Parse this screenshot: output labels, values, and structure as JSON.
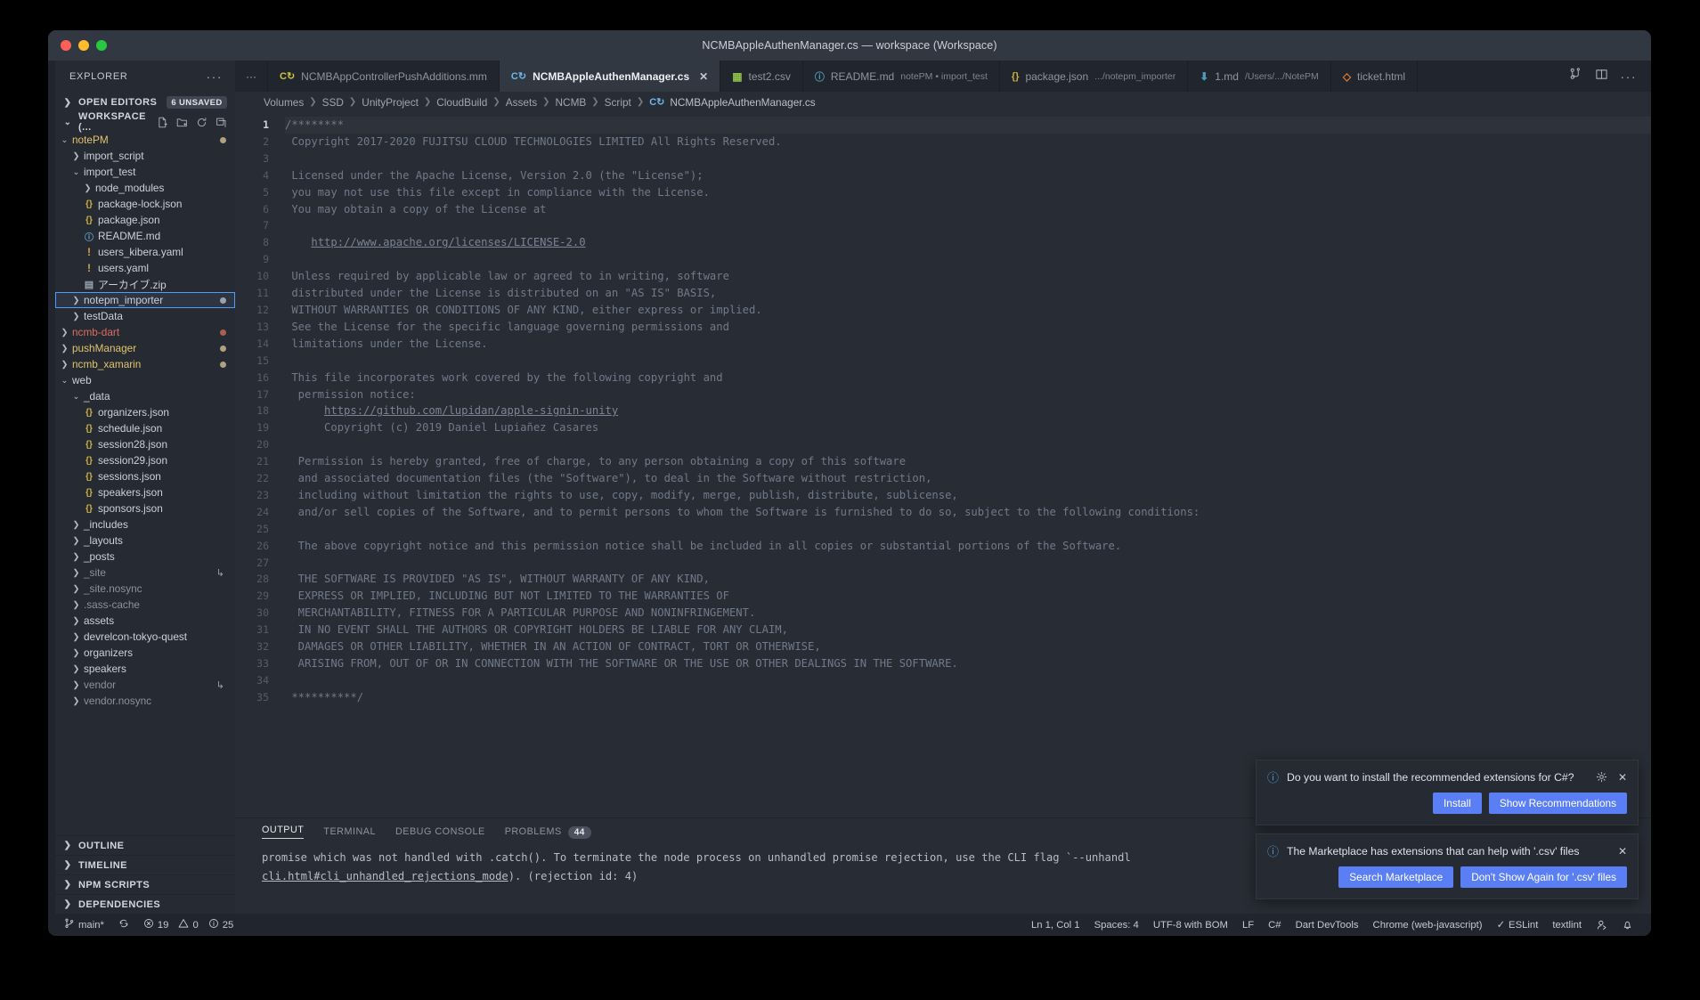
{
  "window": {
    "title": "NCMBAppleAuthenManager.cs — workspace (Workspace)"
  },
  "sidebar": {
    "header": "EXPLORER",
    "sections": {
      "open_editors": "OPEN EDITORS",
      "open_editors_badge": "6 UNSAVED",
      "workspace": "WORKSPACE (..."
    },
    "tree": [
      {
        "label": "notePM",
        "depth": 1,
        "type": "folder",
        "state": "open",
        "color": "folder-y",
        "dot": "tan"
      },
      {
        "label": "import_script",
        "depth": 2,
        "type": "folder",
        "state": "closed",
        "color": ""
      },
      {
        "label": "import_test",
        "depth": 2,
        "type": "folder",
        "state": "open",
        "color": ""
      },
      {
        "label": "node_modules",
        "depth": 3,
        "type": "folder",
        "state": "closed",
        "color": ""
      },
      {
        "label": "package-lock.json",
        "depth": 3,
        "type": "json"
      },
      {
        "label": "package.json",
        "depth": 3,
        "type": "json"
      },
      {
        "label": "README.md",
        "depth": 3,
        "type": "md"
      },
      {
        "label": "users_kibera.yaml",
        "depth": 3,
        "type": "yaml"
      },
      {
        "label": "users.yaml",
        "depth": 3,
        "type": "yaml"
      },
      {
        "label": "アーカイブ.zip",
        "depth": 3,
        "type": "zip"
      },
      {
        "label": "notepm_importer",
        "depth": 2,
        "type": "folder",
        "state": "closed",
        "color": "",
        "selected": true,
        "dot": "gray"
      },
      {
        "label": "testData",
        "depth": 2,
        "type": "folder",
        "state": "closed",
        "color": ""
      },
      {
        "label": "ncmb-dart",
        "depth": 1,
        "type": "folder",
        "state": "closed",
        "color": "folder-r",
        "dot": "red"
      },
      {
        "label": "pushManager",
        "depth": 1,
        "type": "folder",
        "state": "closed",
        "color": "folder-y",
        "dot": "tan"
      },
      {
        "label": "ncmb_xamarin",
        "depth": 1,
        "type": "folder",
        "state": "closed",
        "color": "folder-y",
        "dot": "tan"
      },
      {
        "label": "web",
        "depth": 1,
        "type": "folder",
        "state": "open",
        "color": ""
      },
      {
        "label": "_data",
        "depth": 2,
        "type": "folder",
        "state": "open",
        "color": ""
      },
      {
        "label": "organizers.json",
        "depth": 3,
        "type": "json"
      },
      {
        "label": "schedule.json",
        "depth": 3,
        "type": "json"
      },
      {
        "label": "session28.json",
        "depth": 3,
        "type": "json"
      },
      {
        "label": "session29.json",
        "depth": 3,
        "type": "json"
      },
      {
        "label": "sessions.json",
        "depth": 3,
        "type": "json"
      },
      {
        "label": "speakers.json",
        "depth": 3,
        "type": "json"
      },
      {
        "label": "sponsors.json",
        "depth": 3,
        "type": "json"
      },
      {
        "label": "_includes",
        "depth": 2,
        "type": "folder",
        "state": "closed",
        "color": ""
      },
      {
        "label": "_layouts",
        "depth": 2,
        "type": "folder",
        "state": "closed",
        "color": ""
      },
      {
        "label": "_posts",
        "depth": 2,
        "type": "folder",
        "state": "closed",
        "color": ""
      },
      {
        "label": "_site",
        "depth": 2,
        "type": "folder",
        "state": "closed",
        "color": "dim",
        "symlink": true
      },
      {
        "label": "_site.nosync",
        "depth": 2,
        "type": "folder",
        "state": "closed",
        "color": "dim"
      },
      {
        "label": ".sass-cache",
        "depth": 2,
        "type": "folder",
        "state": "closed",
        "color": "dim"
      },
      {
        "label": "assets",
        "depth": 2,
        "type": "folder",
        "state": "closed",
        "color": ""
      },
      {
        "label": "devrelcon-tokyo-quest",
        "depth": 2,
        "type": "folder",
        "state": "closed",
        "color": ""
      },
      {
        "label": "organizers",
        "depth": 2,
        "type": "folder",
        "state": "closed",
        "color": ""
      },
      {
        "label": "speakers",
        "depth": 2,
        "type": "folder",
        "state": "closed",
        "color": ""
      },
      {
        "label": "vendor",
        "depth": 2,
        "type": "folder",
        "state": "closed",
        "color": "dim",
        "symlink": true
      },
      {
        "label": "vendor.nosync",
        "depth": 2,
        "type": "folder",
        "state": "closed",
        "color": "dim"
      }
    ],
    "bottom_sections": [
      "OUTLINE",
      "TIMELINE",
      "NPM SCRIPTS",
      "DEPENDENCIES"
    ]
  },
  "tabs": [
    {
      "label": "NCMBAppControllerPushAdditions.mm",
      "icon": "mm",
      "sub": "",
      "active": false,
      "closable": false
    },
    {
      "label": "NCMBAppleAuthenManager.cs",
      "icon": "cs",
      "sub": "",
      "active": true,
      "closable": true
    },
    {
      "label": "test2.csv",
      "icon": "csv",
      "sub": "",
      "active": false,
      "closable": false
    },
    {
      "label": "README.md",
      "icon": "md",
      "sub": "notePM • import_test",
      "active": false,
      "closable": false
    },
    {
      "label": "package.json",
      "icon": "json",
      "sub": ".../notepm_importer",
      "active": false,
      "closable": false
    },
    {
      "label": "1.md",
      "icon": "dl",
      "sub": "/Users/.../NotePM",
      "active": false,
      "closable": false
    },
    {
      "label": "ticket.html",
      "icon": "html",
      "sub": "",
      "active": false,
      "closable": false
    }
  ],
  "breadcrumb": [
    "Volumes",
    "SSD",
    "UnityProject",
    "CloudBuild",
    "Assets",
    "NCMB",
    "Script",
    "NCMBAppleAuthenManager.cs"
  ],
  "editor": {
    "first_line": 1,
    "total_lines": 35,
    "lines": [
      "/********",
      " Copyright 2017-2020 FUJITSU CLOUD TECHNOLOGIES LIMITED All Rights Reserved.",
      "",
      " Licensed under the Apache License, Version 2.0 (the \"License\");",
      " you may not use this file except in compliance with the License.",
      " You may obtain a copy of the License at",
      "",
      "    __LINK__http://www.apache.org/licenses/LICENSE-2.0",
      "",
      " Unless required by applicable law or agreed to in writing, software",
      " distributed under the License is distributed on an \"AS IS\" BASIS,",
      " WITHOUT WARRANTIES OR CONDITIONS OF ANY KIND, either express or implied.",
      " See the License for the specific language governing permissions and",
      " limitations under the License.",
      "",
      " This file incorporates work covered by the following copyright and",
      "  permission notice:",
      "      __LINK__https://github.com/lupidan/apple-signin-unity",
      "      Copyright (c) 2019 Daniel Lupiañez Casares",
      "",
      "  Permission is hereby granted, free of charge, to any person obtaining a copy of this software",
      "  and associated documentation files (the \"Software\"), to deal in the Software without restriction,",
      "  including without limitation the rights to use, copy, modify, merge, publish, distribute, sublicense,",
      "  and/or sell copies of the Software, and to permit persons to whom the Software is furnished to do so, subject to the following conditions:",
      "",
      "  The above copyright notice and this permission notice shall be included in all copies or substantial portions of the Software.",
      "",
      "  THE SOFTWARE IS PROVIDED \"AS IS\", WITHOUT WARRANTY OF ANY KIND,",
      "  EXPRESS OR IMPLIED, INCLUDING BUT NOT LIMITED TO THE WARRANTIES OF",
      "  MERCHANTABILITY, FITNESS FOR A PARTICULAR PURPOSE AND NONINFRINGEMENT.",
      "  IN NO EVENT SHALL THE AUTHORS OR COPYRIGHT HOLDERS BE LIABLE FOR ANY CLAIM,",
      "  DAMAGES OR OTHER LIABILITY, WHETHER IN AN ACTION OF CONTRACT, TORT OR OTHERWISE,",
      "  ARISING FROM, OUT OF OR IN CONNECTION WITH THE SOFTWARE OR THE USE OR OTHER DEALINGS IN THE SOFTWARE.",
      "",
      " **********/"
    ]
  },
  "panel": {
    "tabs": [
      {
        "label": "OUTPUT",
        "active": true
      },
      {
        "label": "TERMINAL",
        "active": false
      },
      {
        "label": "DEBUG CONSOLE",
        "active": false
      },
      {
        "label": "PROBLEMS",
        "active": false,
        "badge": "44"
      }
    ],
    "output_line1": "promise which was not handled with .catch(). To terminate the node process on unhandled promise rejection, use the CLI flag `--unhandl",
    "output_line2_link": "cli.html#cli_unhandled_rejections_mode",
    "output_line2_rest": "). (rejection id: 4)"
  },
  "status": {
    "branch": "main*",
    "errors": "19",
    "warnings": "0",
    "infos": "25",
    "position": "Ln 1, Col 1",
    "spaces": "Spaces: 4",
    "encoding": "UTF-8 with BOM",
    "eol": "LF",
    "language": "C#",
    "dart_devtools": "Dart DevTools",
    "chrome": "Chrome (web-javascript)",
    "eslint": "ESLint",
    "textlint": "textlint"
  },
  "notifications": [
    {
      "message": "Do you want to install the recommended extensions for C#?",
      "has_gear": true,
      "buttons": [
        "Install",
        "Show Recommendations"
      ]
    },
    {
      "message": "The Marketplace has extensions that can help with '.csv' files",
      "has_gear": false,
      "buttons": [
        "Search Marketplace",
        "Don't Show Again for '.csv' files"
      ]
    }
  ],
  "colors": {
    "accent": "#5a7ff5",
    "selection_border": "#4a9eff",
    "bg": "#282c34",
    "sidebar_bg": "#252a33"
  }
}
